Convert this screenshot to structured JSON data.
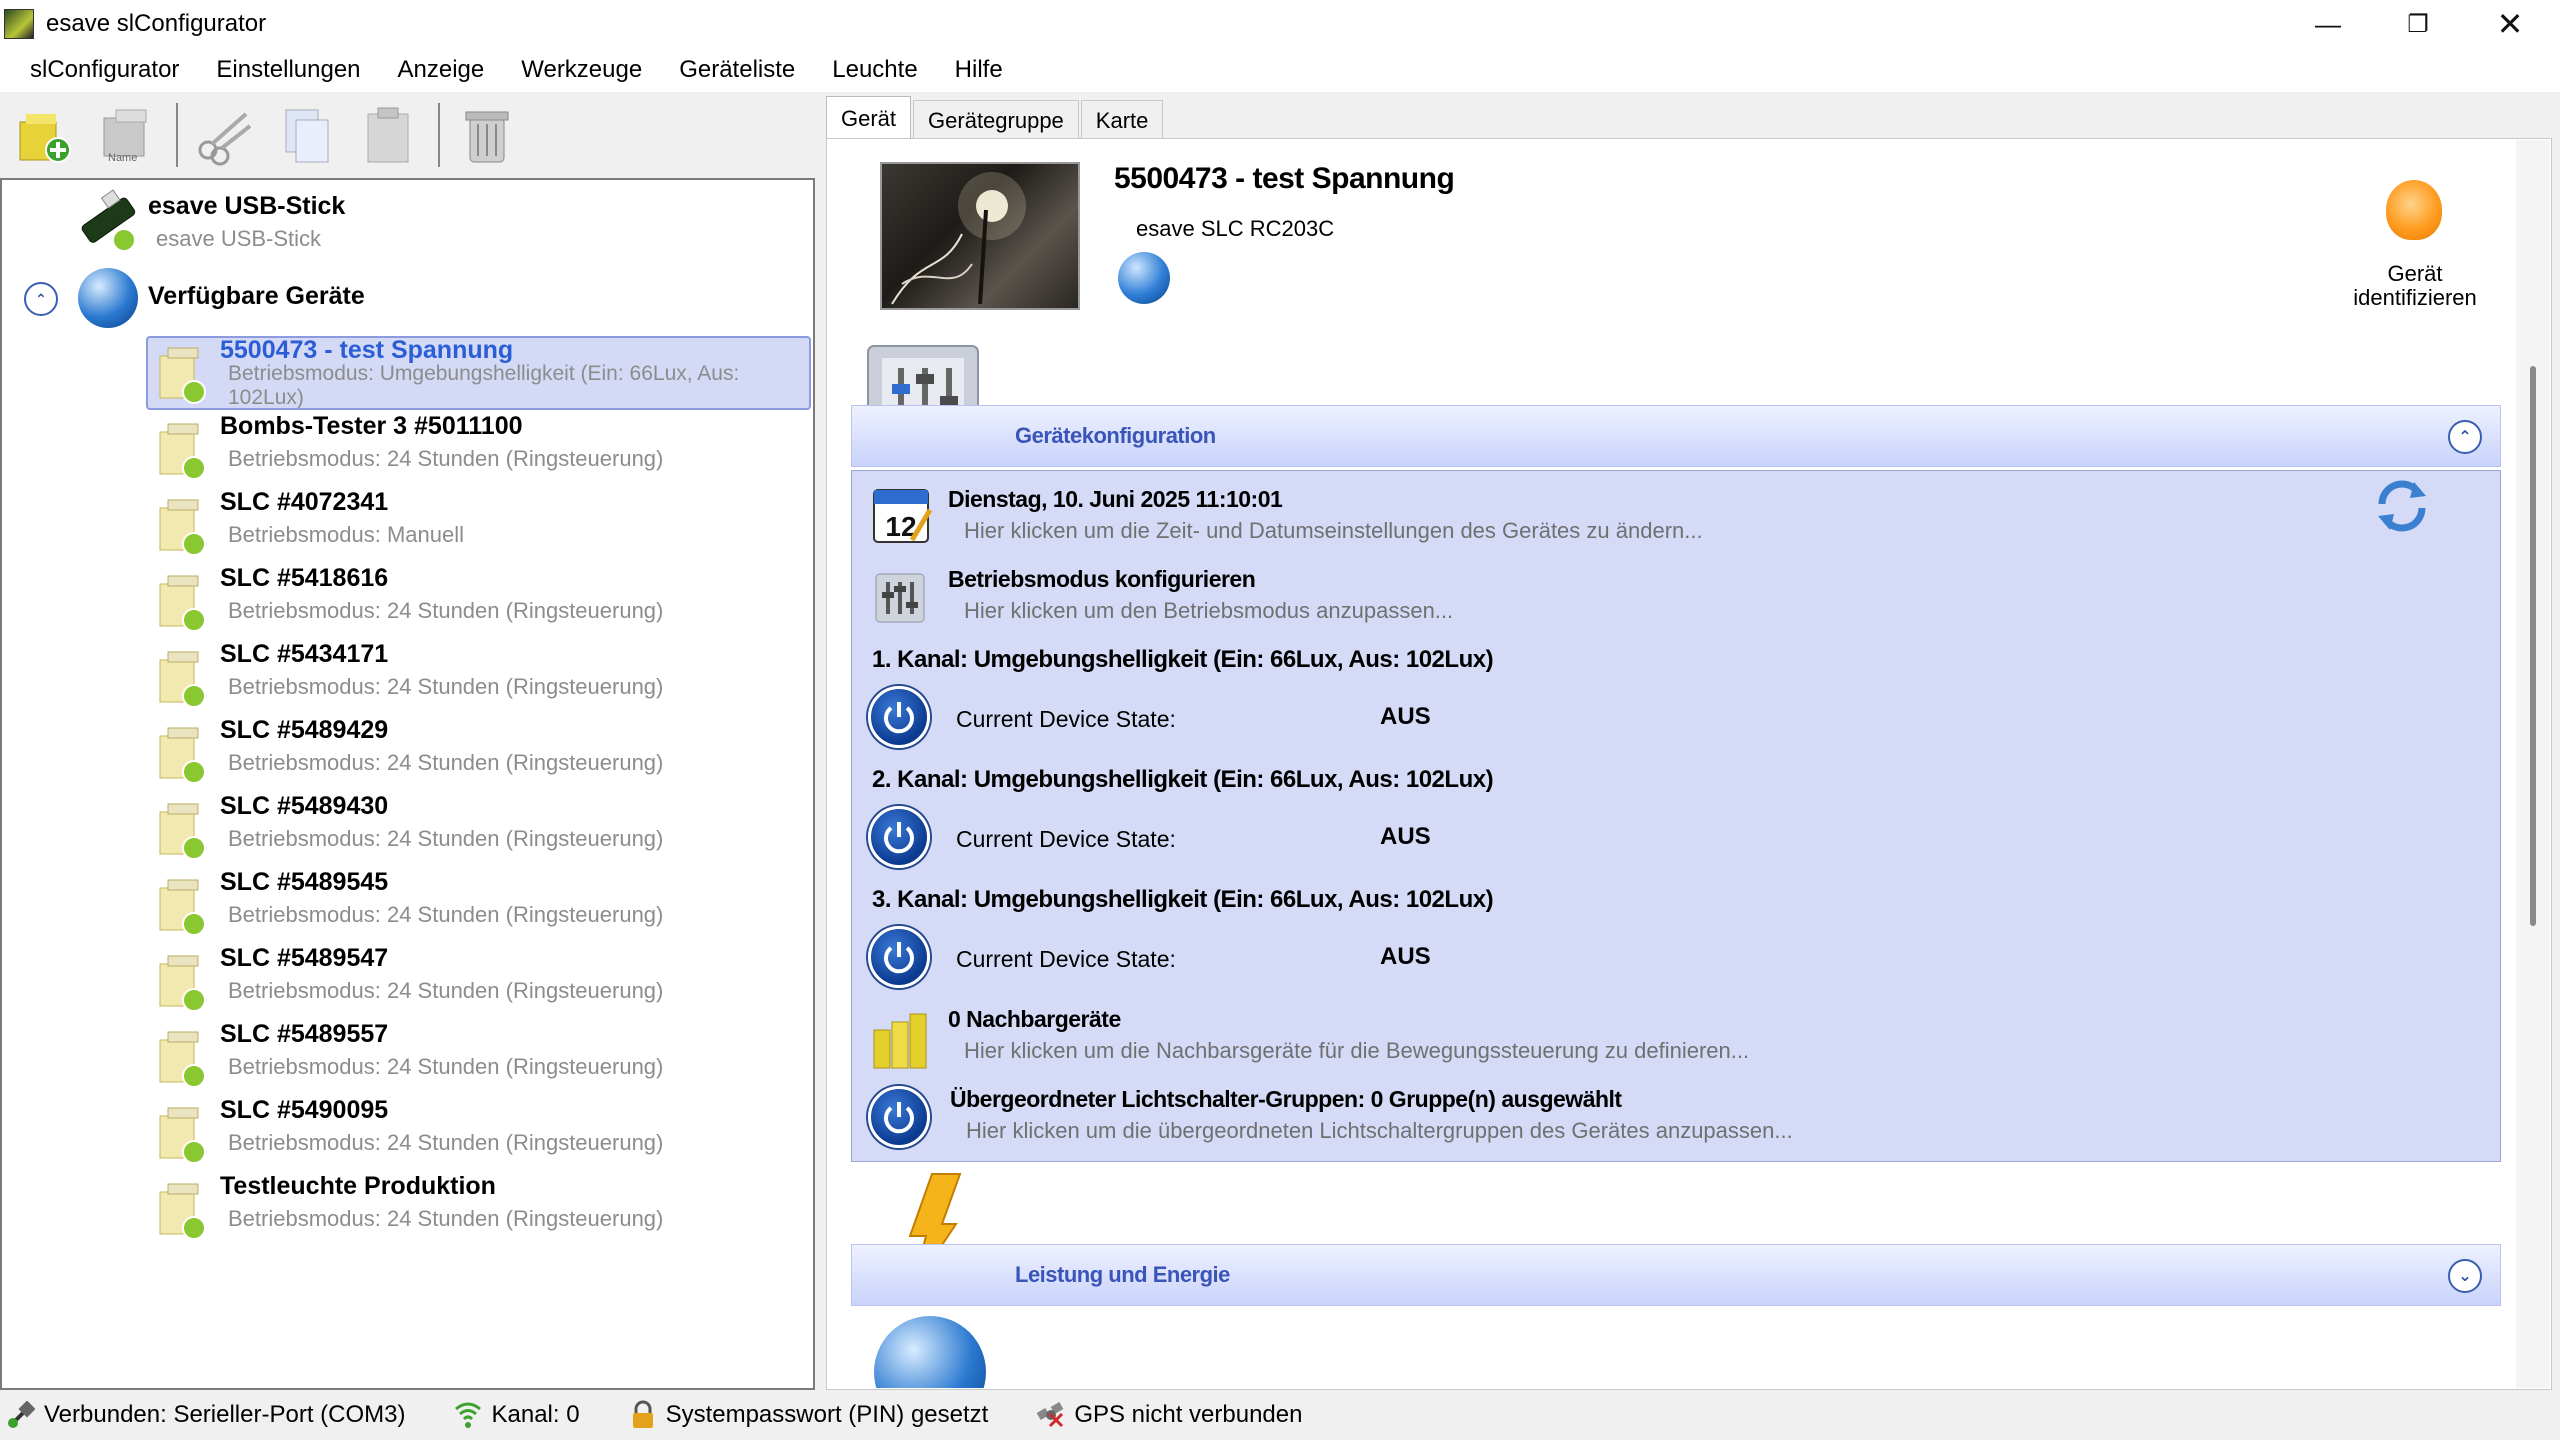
{
  "window": {
    "title": "esave slConfigurator"
  },
  "menu": [
    "slConfigurator",
    "Einstellungen",
    "Anzeige",
    "Werkzeuge",
    "Geräteliste",
    "Leuchte",
    "Hilfe"
  ],
  "toolbar": {
    "name_label": "Name"
  },
  "tree": {
    "usb": {
      "title": "esave USB-Stick",
      "sub": "esave USB-Stick"
    },
    "group": {
      "title": "Verfügbare Geräte"
    },
    "devices": [
      {
        "title": "5500473 - test Spannung",
        "sub": "Betriebsmodus: Umgebungshelligkeit (Ein: 66Lux, Aus: 102Lux)",
        "selected": true
      },
      {
        "title": "Bombs-Tester 3 #5011100",
        "sub": "Betriebsmodus: 24 Stunden (Ringsteuerung)"
      },
      {
        "title": "SLC #4072341",
        "sub": "Betriebsmodus: Manuell"
      },
      {
        "title": "SLC #5418616",
        "sub": "Betriebsmodus: 24 Stunden (Ringsteuerung)"
      },
      {
        "title": "SLC #5434171",
        "sub": "Betriebsmodus: 24 Stunden (Ringsteuerung)"
      },
      {
        "title": "SLC #5489429",
        "sub": "Betriebsmodus: 24 Stunden (Ringsteuerung)"
      },
      {
        "title": "SLC #5489430",
        "sub": "Betriebsmodus: 24 Stunden (Ringsteuerung)"
      },
      {
        "title": "SLC #5489545",
        "sub": "Betriebsmodus: 24 Stunden (Ringsteuerung)"
      },
      {
        "title": "SLC #5489547",
        "sub": "Betriebsmodus: 24 Stunden (Ringsteuerung)"
      },
      {
        "title": "SLC #5489557",
        "sub": "Betriebsmodus: 24 Stunden (Ringsteuerung)"
      },
      {
        "title": "SLC #5490095",
        "sub": "Betriebsmodus: 24 Stunden (Ringsteuerung)"
      },
      {
        "title": "Testleuchte Produktion",
        "sub": "Betriebsmodus: 24 Stunden (Ringsteuerung)"
      }
    ]
  },
  "tabs": [
    "Gerät",
    "Gerätegruppe",
    "Karte"
  ],
  "device": {
    "title": "5500473 - test Spannung",
    "model": "esave SLC RC203C",
    "identify_label_1": "Gerät",
    "identify_label_2": "identifizieren"
  },
  "config": {
    "header": "Gerätekonfiguration",
    "datetime_title": "Dienstag, 10. Juni 2025 11:10:01",
    "datetime_sub": "Hier klicken um die Zeit- und Datumseinstellungen des Gerätes zu ändern...",
    "calendar_day": "12",
    "mode_title": "Betriebsmodus konfigurieren",
    "mode_sub": "Hier klicken um den Betriebsmodus anzupassen...",
    "channels": [
      {
        "title": "1. Kanal: Umgebungshelligkeit (Ein: 66Lux, Aus: 102Lux)",
        "state_label": "Current Device State:",
        "state": "AUS"
      },
      {
        "title": "2. Kanal: Umgebungshelligkeit (Ein: 66Lux, Aus: 102Lux)",
        "state_label": "Current Device State:",
        "state": "AUS"
      },
      {
        "title": "3. Kanal: Umgebungshelligkeit (Ein: 66Lux, Aus: 102Lux)",
        "state_label": "Current Device State:",
        "state": "AUS"
      }
    ],
    "neighbors_title": "0 Nachbargeräte",
    "neighbors_sub": "Hier klicken um die Nachbarsgeräte für die Bewegungssteuerung zu definieren...",
    "switchgroups_title": "Übergeordneter Lichtschalter-Gruppen: 0 Gruppe(n) ausgewählt",
    "switchgroups_sub": "Hier klicken um die übergeordneten Lichtschaltergruppen des Gerätes anzupassen..."
  },
  "power_section": {
    "header": "Leistung und Energie"
  },
  "status": {
    "connection": "Verbunden: Serieller-Port (COM3)",
    "channel": "Kanal: 0",
    "pin": "Systempasswort (PIN) gesetzt",
    "gps": "GPS nicht verbunden"
  }
}
